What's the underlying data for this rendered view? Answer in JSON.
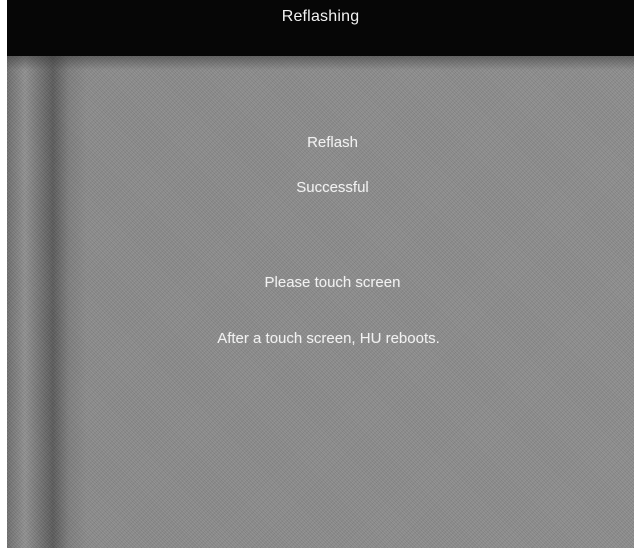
{
  "window": {
    "title": "Reflashing"
  },
  "status": {
    "line1": "Reflash",
    "line2": "Successful"
  },
  "instructions": {
    "line1": "Please touch screen",
    "line2": "After a touch screen, HU reboots."
  },
  "colors": {
    "title_bar": "#060606",
    "screen_background": "#8b8b8b",
    "text": "#f1f1f1"
  }
}
